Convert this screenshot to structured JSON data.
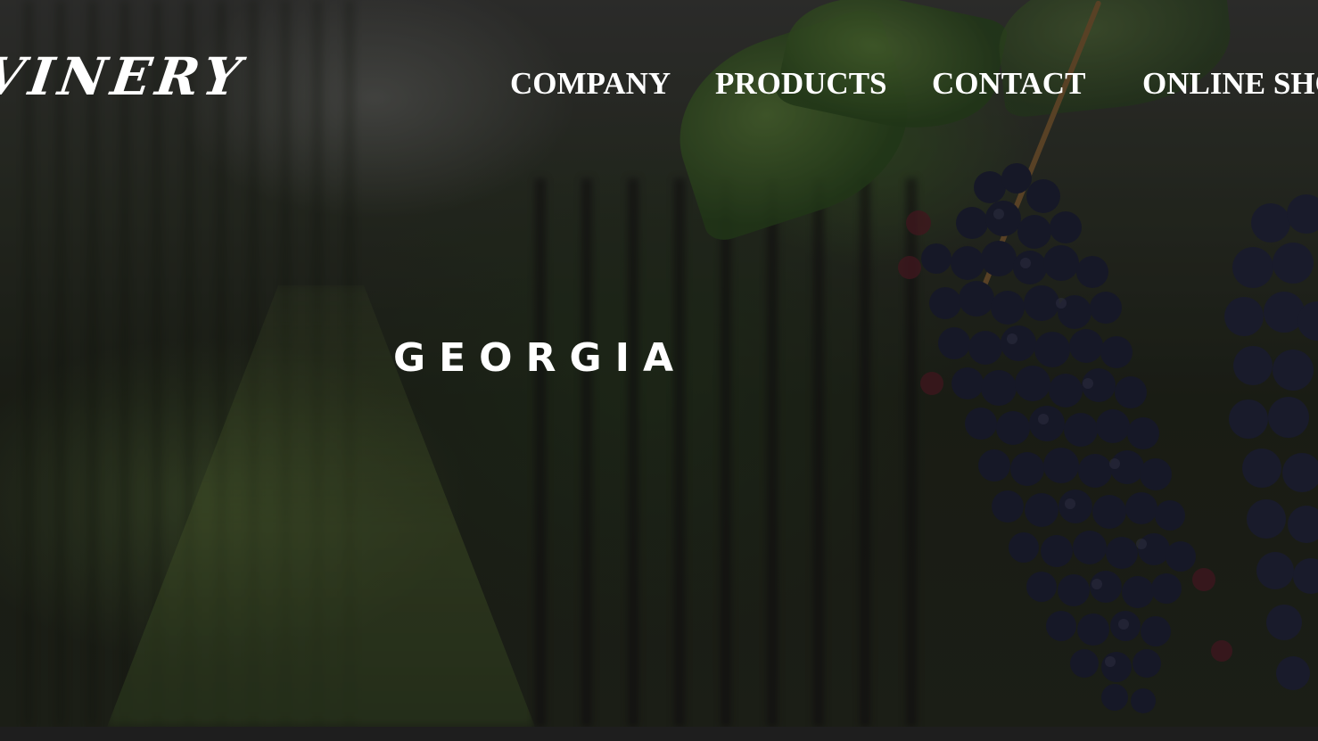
{
  "brand": {
    "logo_text": "VINERY"
  },
  "nav": {
    "items": [
      {
        "label": "COMPANY"
      },
      {
        "label": "PRODUCTS"
      },
      {
        "label": "CONTACT"
      },
      {
        "label": "ONLINE SHO"
      }
    ]
  },
  "hero": {
    "title": "GEORGIA"
  },
  "colors": {
    "text": "#ffffff",
    "bottom_bar": "#1e1e1e"
  }
}
